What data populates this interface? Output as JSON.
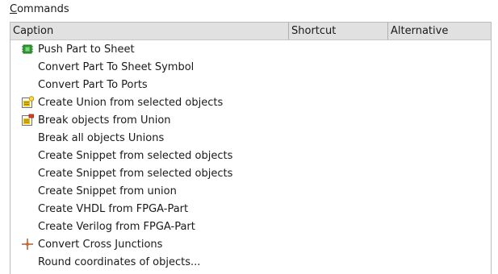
{
  "section": {
    "label_mnemonic": "C",
    "label_rest": "ommands"
  },
  "table": {
    "columns": [
      "Caption",
      "Shortcut",
      "Alternative"
    ],
    "rows": [
      {
        "caption": "Push Part to Sheet",
        "icon": "chip-green-icon"
      },
      {
        "caption": "Convert Part To Sheet Symbol",
        "icon": ""
      },
      {
        "caption": "Convert Part To Ports",
        "icon": ""
      },
      {
        "caption": "Create Union from selected objects",
        "icon": "union-create-icon"
      },
      {
        "caption": "Break objects from Union",
        "icon": "union-break-icon"
      },
      {
        "caption": "Break all objects Unions",
        "icon": ""
      },
      {
        "caption": "Create Snippet from selected objects",
        "icon": ""
      },
      {
        "caption": "Create Snippet from selected objects",
        "icon": ""
      },
      {
        "caption": "Create Snippet from union",
        "icon": ""
      },
      {
        "caption": "Create VHDL from FPGA-Part",
        "icon": ""
      },
      {
        "caption": "Create Verilog from FPGA-Part",
        "icon": ""
      },
      {
        "caption": "Convert Cross Junctions",
        "icon": "cross-junction-icon"
      },
      {
        "caption": "Round coordinates of objects...",
        "icon": ""
      }
    ]
  },
  "colors": {
    "header_bg": "#e1e1e1",
    "chip_green": "#2e9e2e",
    "union_yellow": "#f2c200",
    "union_red": "#e0402a",
    "junction_brown": "#a0522d"
  }
}
